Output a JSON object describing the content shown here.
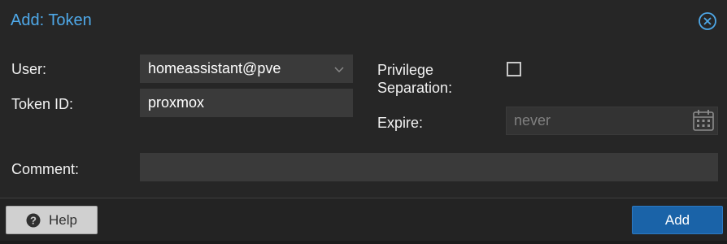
{
  "dialog": {
    "title": "Add: Token"
  },
  "form": {
    "user_label": "User:",
    "user_value": "homeassistant@pve",
    "token_id_label": "Token ID:",
    "token_id_value": "proxmox",
    "privilege_label_line1": "Privilege",
    "privilege_label_line2": "Separation:",
    "privilege_checked": false,
    "expire_label": "Expire:",
    "expire_placeholder": "never",
    "comment_label": "Comment:",
    "comment_value": ""
  },
  "footer": {
    "help_label": "Help",
    "add_label": "Add"
  },
  "colors": {
    "accent": "#4ea8e8",
    "primary_button": "#1a63a8",
    "background": "#262626"
  },
  "icons": {
    "close": "close-circle-icon",
    "dropdown": "chevron-down-icon",
    "calendar": "calendar-icon",
    "help": "question-circle-icon"
  }
}
